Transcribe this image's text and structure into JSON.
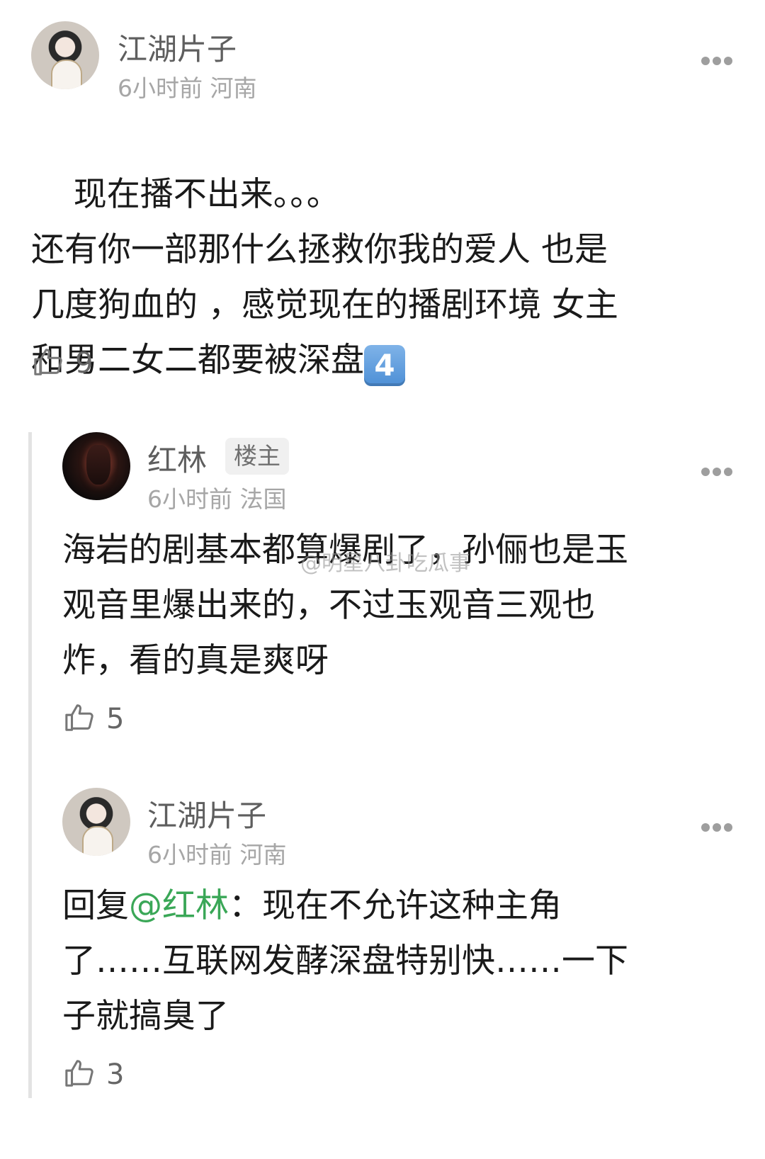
{
  "comments": [
    {
      "name": "江湖片子",
      "meta": "6小时前 河南",
      "body": "现在播不出来。。。\n还有你一部那什么拯救你我的爱人 也是\n几度狗血的 ，感觉现在的播剧环境 女主\n和男二女二都要被深盘",
      "emoji": "4",
      "likes": "9"
    },
    {
      "name": "红林",
      "badge": "楼主",
      "meta": "6小时前 法国",
      "body": "海岩的剧基本都算爆剧了，孙俪也是玉\n观音里爆出来的，不过玉观音三观也\n炸，看的真是爽呀",
      "likes": "5"
    },
    {
      "name": "江湖片子",
      "meta": "6小时前 河南",
      "reply_prefix": "回复",
      "mention": "@红林",
      "body": "：现在不允许这种主角\n了……互联网发酵深盘特别快……一下\n子就搞臭了",
      "likes": "3"
    }
  ],
  "watermark": "@明星八卦吃瓜事",
  "icons": {
    "like": "thumbs-up-icon",
    "more": "more-dots-icon"
  },
  "colors": {
    "mention": "#3aa757",
    "name": "#5e5e5e",
    "meta": "#a6a6a6"
  }
}
